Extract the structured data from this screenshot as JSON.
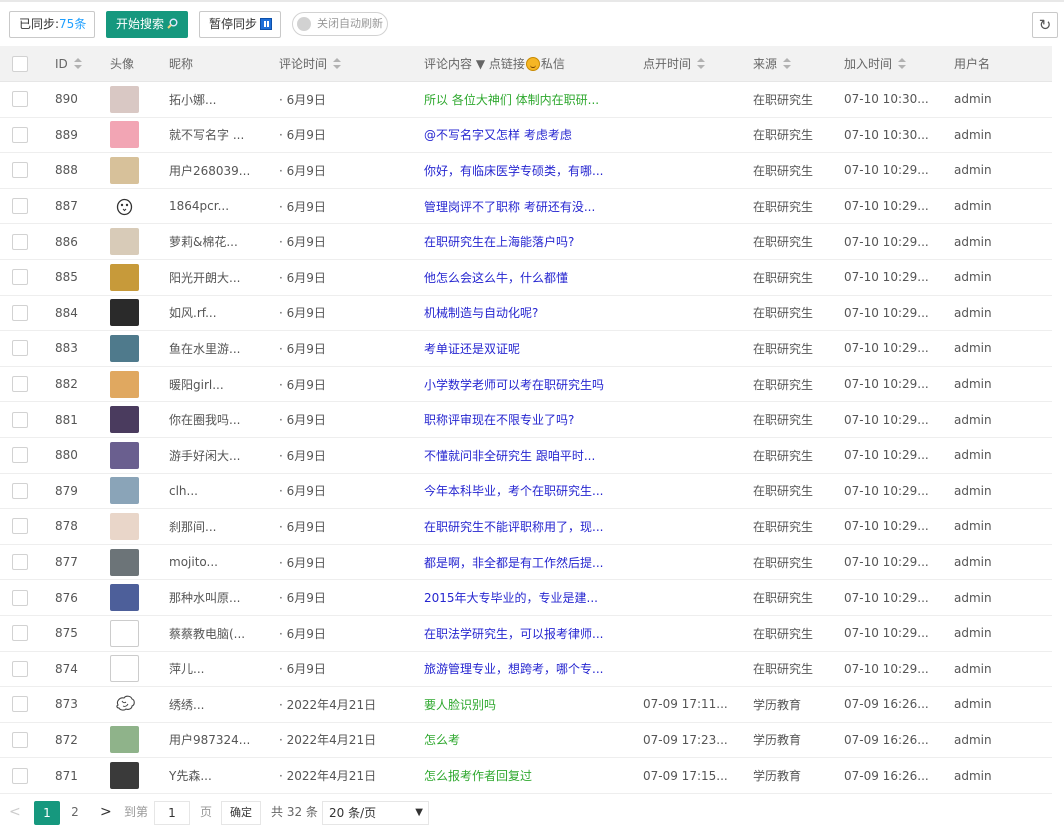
{
  "toolbar": {
    "synced_label": "已同步:",
    "synced_count": "75条",
    "start_label": "开始搜索",
    "pause_label": "暂停同步",
    "auto_refresh_label": "关闭自动刷新"
  },
  "table": {
    "headers": {
      "id": "ID",
      "avatar": "头像",
      "nickname": "昵称",
      "comment_time": "评论时间",
      "content_pre": "评论内容 ▼ 点链接",
      "content_post": "私信",
      "open_time": "点开时间",
      "source": "来源",
      "join_time": "加入时间",
      "username": "用户名"
    },
    "rows": [
      {
        "id": "890",
        "nickname": "拓小娜...",
        "comment_time": "· 6月9日",
        "content": "所以 各位大神们 体制内在职研...",
        "content_color": "green",
        "open_time": "",
        "source": "在职研究生",
        "join_time": "07-10 10:30...",
        "username": "admin",
        "avatar_color": "#d9c8c4",
        "avatar_kind": "photo"
      },
      {
        "id": "889",
        "nickname": "就不写名字 ...",
        "comment_time": "· 6月9日",
        "content": "@不写名字又怎样 考虑考虑",
        "content_color": "blue",
        "open_time": "",
        "source": "在职研究生",
        "join_time": "07-10 10:30...",
        "username": "admin",
        "avatar_color": "#f2a5b4",
        "avatar_kind": "photo"
      },
      {
        "id": "888",
        "nickname": "用户268039...",
        "comment_time": "· 6月9日",
        "content": "你好，有临床医学专硕类，有哪...",
        "content_color": "blue",
        "open_time": "",
        "source": "在职研究生",
        "join_time": "07-10 10:29...",
        "username": "admin",
        "avatar_color": "#d7c19a",
        "avatar_kind": "photo"
      },
      {
        "id": "887",
        "nickname": "1864pcr...",
        "comment_time": "· 6月9日",
        "content": "管理岗评不了职称 考研还有没...",
        "content_color": "blue",
        "open_time": "",
        "source": "在职研究生",
        "join_time": "07-10 10:29...",
        "username": "admin",
        "avatar_color": "#ffffff",
        "avatar_kind": "bird"
      },
      {
        "id": "886",
        "nickname": "萝莉&棉花...",
        "comment_time": "· 6月9日",
        "content": "在职研究生在上海能落户吗?",
        "content_color": "blue",
        "open_time": "",
        "source": "在职研究生",
        "join_time": "07-10 10:29...",
        "username": "admin",
        "avatar_color": "#d8cbb8",
        "avatar_kind": "photo"
      },
      {
        "id": "885",
        "nickname": "阳光开朗大...",
        "comment_time": "· 6月9日",
        "content": "他怎么会这么牛，什么都懂",
        "content_color": "blue",
        "open_time": "",
        "source": "在职研究生",
        "join_time": "07-10 10:29...",
        "username": "admin",
        "avatar_color": "#c79a3a",
        "avatar_kind": "photo"
      },
      {
        "id": "884",
        "nickname": "如风.rf...",
        "comment_time": "· 6月9日",
        "content": "机械制造与自动化呢?",
        "content_color": "blue",
        "open_time": "",
        "source": "在职研究生",
        "join_time": "07-10 10:29...",
        "username": "admin",
        "avatar_color": "#2a2a2a",
        "avatar_kind": "photo"
      },
      {
        "id": "883",
        "nickname": "鱼在水里游...",
        "comment_time": "· 6月9日",
        "content": "考单证还是双证呢",
        "content_color": "blue",
        "open_time": "",
        "source": "在职研究生",
        "join_time": "07-10 10:29...",
        "username": "admin",
        "avatar_color": "#4f7a8c",
        "avatar_kind": "photo"
      },
      {
        "id": "882",
        "nickname": "暖阳girl...",
        "comment_time": "· 6月9日",
        "content": "小学数学老师可以考在职研究生吗",
        "content_color": "blue",
        "open_time": "",
        "source": "在职研究生",
        "join_time": "07-10 10:29...",
        "username": "admin",
        "avatar_color": "#e0a860",
        "avatar_kind": "photo"
      },
      {
        "id": "881",
        "nickname": "你在圈我吗...",
        "comment_time": "· 6月9日",
        "content": "职称评审现在不限专业了吗?",
        "content_color": "blue",
        "open_time": "",
        "source": "在职研究生",
        "join_time": "07-10 10:29...",
        "username": "admin",
        "avatar_color": "#4a3b5e",
        "avatar_kind": "photo"
      },
      {
        "id": "880",
        "nickname": "游手好闲大...",
        "comment_time": "· 6月9日",
        "content": "不懂就问非全研究生 跟咱平时...",
        "content_color": "blue",
        "open_time": "",
        "source": "在职研究生",
        "join_time": "07-10 10:29...",
        "username": "admin",
        "avatar_color": "#6a5f8f",
        "avatar_kind": "photo"
      },
      {
        "id": "879",
        "nickname": "clh...",
        "comment_time": "· 6月9日",
        "content": "今年本科毕业，考个在职研究生...",
        "content_color": "blue",
        "open_time": "",
        "source": "在职研究生",
        "join_time": "07-10 10:29...",
        "username": "admin",
        "avatar_color": "#8aa4b8",
        "avatar_kind": "photo"
      },
      {
        "id": "878",
        "nickname": "刹那间...",
        "comment_time": "· 6月9日",
        "content": "在职研究生不能评职称用了，现...",
        "content_color": "blue",
        "open_time": "",
        "source": "在职研究生",
        "join_time": "07-10 10:29...",
        "username": "admin",
        "avatar_color": "#e9d6c9",
        "avatar_kind": "photo"
      },
      {
        "id": "877",
        "nickname": "mojito...",
        "comment_time": "· 6月9日",
        "content": "都是啊，非全都是有工作然后提...",
        "content_color": "blue",
        "open_time": "",
        "source": "在职研究生",
        "join_time": "07-10 10:29...",
        "username": "admin",
        "avatar_color": "#6c7478",
        "avatar_kind": "photo"
      },
      {
        "id": "876",
        "nickname": "那种水叫原...",
        "comment_time": "· 6月9日",
        "content": "2015年大专毕业的，专业是建...",
        "content_color": "blue",
        "open_time": "",
        "source": "在职研究生",
        "join_time": "07-10 10:29...",
        "username": "admin",
        "avatar_color": "#4d5f9a",
        "avatar_kind": "photo"
      },
      {
        "id": "875",
        "nickname": "蔡蔡教电脑(...",
        "comment_time": "· 6月9日",
        "content": "在职法学研究生，可以报考律师...",
        "content_color": "blue",
        "open_time": "",
        "source": "在职研究生",
        "join_time": "07-10 10:29...",
        "username": "admin",
        "avatar_color": "#ffffff",
        "avatar_kind": "blank"
      },
      {
        "id": "874",
        "nickname": "萍儿...",
        "comment_time": "· 6月9日",
        "content": "旅游管理专业，想跨考，哪个专...",
        "content_color": "blue",
        "open_time": "",
        "source": "在职研究生",
        "join_time": "07-10 10:29...",
        "username": "admin",
        "avatar_color": "#ffffff",
        "avatar_kind": "blank"
      },
      {
        "id": "873",
        "nickname": "绣绣...",
        "comment_time": "· 2022年4月21日",
        "content": "要人脸识别吗",
        "content_color": "green",
        "open_time": "07-09 17:11...",
        "source": "学历教育",
        "join_time": "07-09 16:26...",
        "username": "admin",
        "avatar_color": "#ffffff",
        "avatar_kind": "brain"
      },
      {
        "id": "872",
        "nickname": "用户987324...",
        "comment_time": "· 2022年4月21日",
        "content": "怎么考",
        "content_color": "green",
        "open_time": "07-09 17:23...",
        "source": "学历教育",
        "join_time": "07-09 16:26...",
        "username": "admin",
        "avatar_color": "#8fb38a",
        "avatar_kind": "photo"
      },
      {
        "id": "871",
        "nickname": "Y先森...",
        "comment_time": "· 2022年4月21日",
        "content": "怎么报考作者回复过",
        "content_color": "green",
        "open_time": "07-09 17:15...",
        "source": "学历教育",
        "join_time": "07-09 16:26...",
        "username": "admin",
        "avatar_color": "#3a3a3a",
        "avatar_kind": "photo"
      }
    ]
  },
  "pagination": {
    "prev": "<",
    "current": "1",
    "page2": "2",
    "next": ">",
    "goto_label": "到第",
    "goto_value": "1",
    "page_unit": "页",
    "confirm": "确定",
    "total": "共 32 条",
    "page_size": "20 条/页"
  },
  "colors": {
    "primary": "#16987e",
    "link_blue": "#2626d0",
    "link_green": "#2ea82e"
  }
}
